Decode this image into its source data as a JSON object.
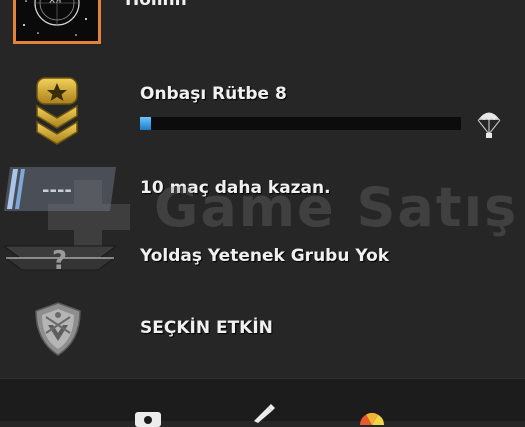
{
  "profile": {
    "name": "Holinn"
  },
  "rank": {
    "title": "Onbaşı Rütbe 8",
    "progress": 0.035,
    "reward_icon": "parachute-icon"
  },
  "wins": {
    "text": "10 maç daha kazan.",
    "placeholder_badge": "----"
  },
  "skill_group": {
    "text": "Yoldaş Yetenek Grubu Yok",
    "badge_glyph": "?"
  },
  "elite": {
    "text": "SEÇKİN ETKİN"
  },
  "watermark": {
    "text": "Game Satış"
  },
  "footer": {
    "icons": [
      "profile-icon",
      "pencil-icon",
      "color-wheel-icon"
    ]
  },
  "colors": {
    "accent": "#e4823a",
    "xp_fill": "#3a9be8",
    "background": "#262626"
  }
}
